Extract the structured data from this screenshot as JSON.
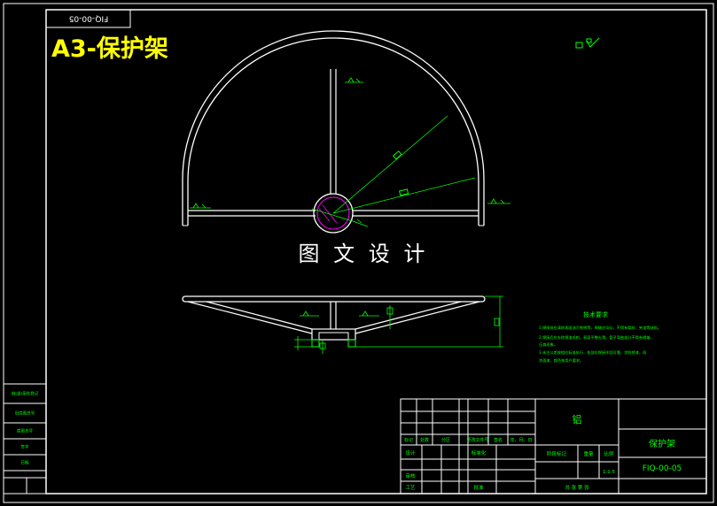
{
  "sheet": {
    "code_flipped": "FIQ-00-05",
    "title": "A3-保护架",
    "watermark": "图 文 设 计"
  },
  "tech_req": {
    "heading": "技术要求",
    "lines": [
      "1.焊接前应清除表面油污铁锈等，焊缝应均匀，不得有裂纹、夹渣等缺陷。",
      "2.焊接后应去除焊渣毛刺，表面平整光滑，管子弯曲部分不得有褶皱，",
      "  压扁现象。",
      "3.未注公差按相应标准执行，各部位焊接牢固可靠，涂防锈漆，再",
      "  涂面漆，颜色按用户要求。"
    ]
  },
  "title_block": {
    "material": "铝",
    "part_name": "保护架",
    "drawing_no": "FIQ-00-05",
    "scale_value": "1:1.5",
    "cols": [
      "标记",
      "处数",
      "分区",
      "更改文件号",
      "签名",
      "年、月、日"
    ],
    "design": "设计",
    "standard": "标准化",
    "check": "审核",
    "craft": "工艺",
    "approve": "批准",
    "stage_mark": "阶段标记",
    "weight": "重量",
    "scale": "比例",
    "sheets": "共    张    第    张"
  },
  "side_block": {
    "rows": [
      "借(通)用件登记",
      "旧底图总号",
      "底图总号",
      "签字",
      "日期"
    ]
  },
  "colors": {
    "frame": "#ffffff",
    "dim": "#00ff00",
    "title_text": "#ffff00",
    "hatch": "#ff00ff"
  }
}
